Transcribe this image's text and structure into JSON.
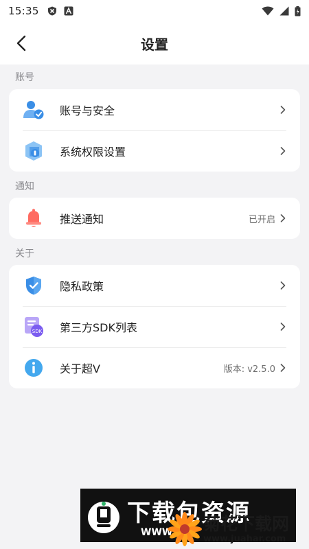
{
  "status_bar": {
    "time": "15:35",
    "icons": [
      "shield-status-icon",
      "a-status-icon",
      "wifi-icon",
      "signal-icon",
      "battery-icon"
    ]
  },
  "header": {
    "title": "设置",
    "back_icon": "chevron-left-icon"
  },
  "sections": [
    {
      "label": "账号",
      "items": [
        {
          "label": "账号与安全",
          "icon": "account-security-icon",
          "value": ""
        },
        {
          "label": "系统权限设置",
          "icon": "system-permission-icon",
          "value": ""
        }
      ]
    },
    {
      "label": "通知",
      "items": [
        {
          "label": "推送通知",
          "icon": "bell-icon",
          "value": "已开启"
        }
      ]
    },
    {
      "label": "关于",
      "items": [
        {
          "label": "隐私政策",
          "icon": "privacy-shield-icon",
          "value": ""
        },
        {
          "label": "第三方SDK列表",
          "icon": "sdk-list-icon",
          "value": ""
        },
        {
          "label": "关于超V",
          "icon": "info-icon",
          "value": "版本: v2.5.0"
        }
      ]
    }
  ],
  "watermarks": {
    "download": {
      "title": "下载包资源",
      "sub": "WWW"
    },
    "juhua": {
      "name": "菊花下载网",
      "url": "www.juahar.com"
    }
  },
  "colors": {
    "background": "#f3f3f5",
    "card": "#ffffff",
    "secondary_text": "#8a8a8e",
    "icon_blue": "#3a8ee6",
    "icon_purple": "#7b5cf0",
    "bell_red": "#ff6b61"
  }
}
